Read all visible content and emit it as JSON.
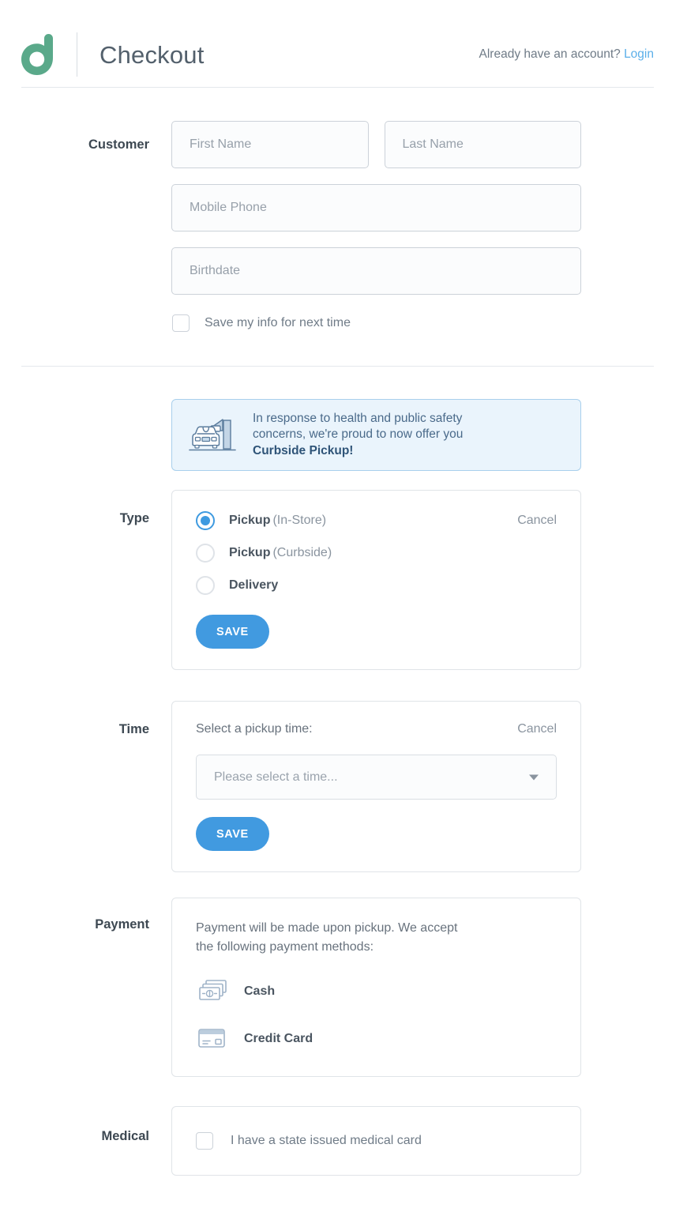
{
  "header": {
    "logo_name": "logo-d-mark",
    "title": "Checkout",
    "account_prompt": "Already have an account?",
    "login_label": "Login",
    "logo_color": "#5aa98a",
    "link_color": "#5bafe9"
  },
  "customer": {
    "label": "Customer",
    "first_name_placeholder": "First Name",
    "first_name_value": "",
    "last_name_placeholder": "Last Name",
    "last_name_value": "",
    "mobile_phone_placeholder": "Mobile Phone",
    "mobile_phone_value": "",
    "birthdate_placeholder": "Birthdate",
    "birthdate_value": "",
    "save_info_label": "Save my info for next time",
    "save_info_checked": false
  },
  "banner": {
    "icon": "car-curbside-icon",
    "line1": "In response to health and public safety",
    "line2": "concerns, we're proud to now offer you",
    "emphasis": "Curbside Pickup!",
    "bg_color": "#eaf4fc",
    "border_color": "#a8cfec"
  },
  "type": {
    "label": "Type",
    "cancel_label": "Cancel",
    "save_label": "SAVE",
    "selected_index": 0,
    "options": [
      {
        "bold": "Pickup",
        "rest": "(In-Store)",
        "checked": true
      },
      {
        "bold": "Pickup",
        "rest": "(Curbside)",
        "checked": false
      },
      {
        "bold": "Delivery",
        "rest": "",
        "checked": false
      }
    ],
    "accent_color": "#419ae0"
  },
  "time": {
    "label": "Time",
    "prompt": "Select a pickup time:",
    "cancel_label": "Cancel",
    "select_placeholder": "Please select a time...",
    "select_value": "",
    "save_label": "SAVE"
  },
  "payment": {
    "label": "Payment",
    "description_line1": "Payment will be made upon pickup. We accept",
    "description_line2": "the following payment methods:",
    "methods": [
      {
        "icon": "cash-icon",
        "label": "Cash"
      },
      {
        "icon": "credit-card-icon",
        "label": "Credit Card"
      }
    ]
  },
  "medical": {
    "label": "Medical",
    "checkbox_label": "I have a state issued medical card",
    "checked": false
  }
}
